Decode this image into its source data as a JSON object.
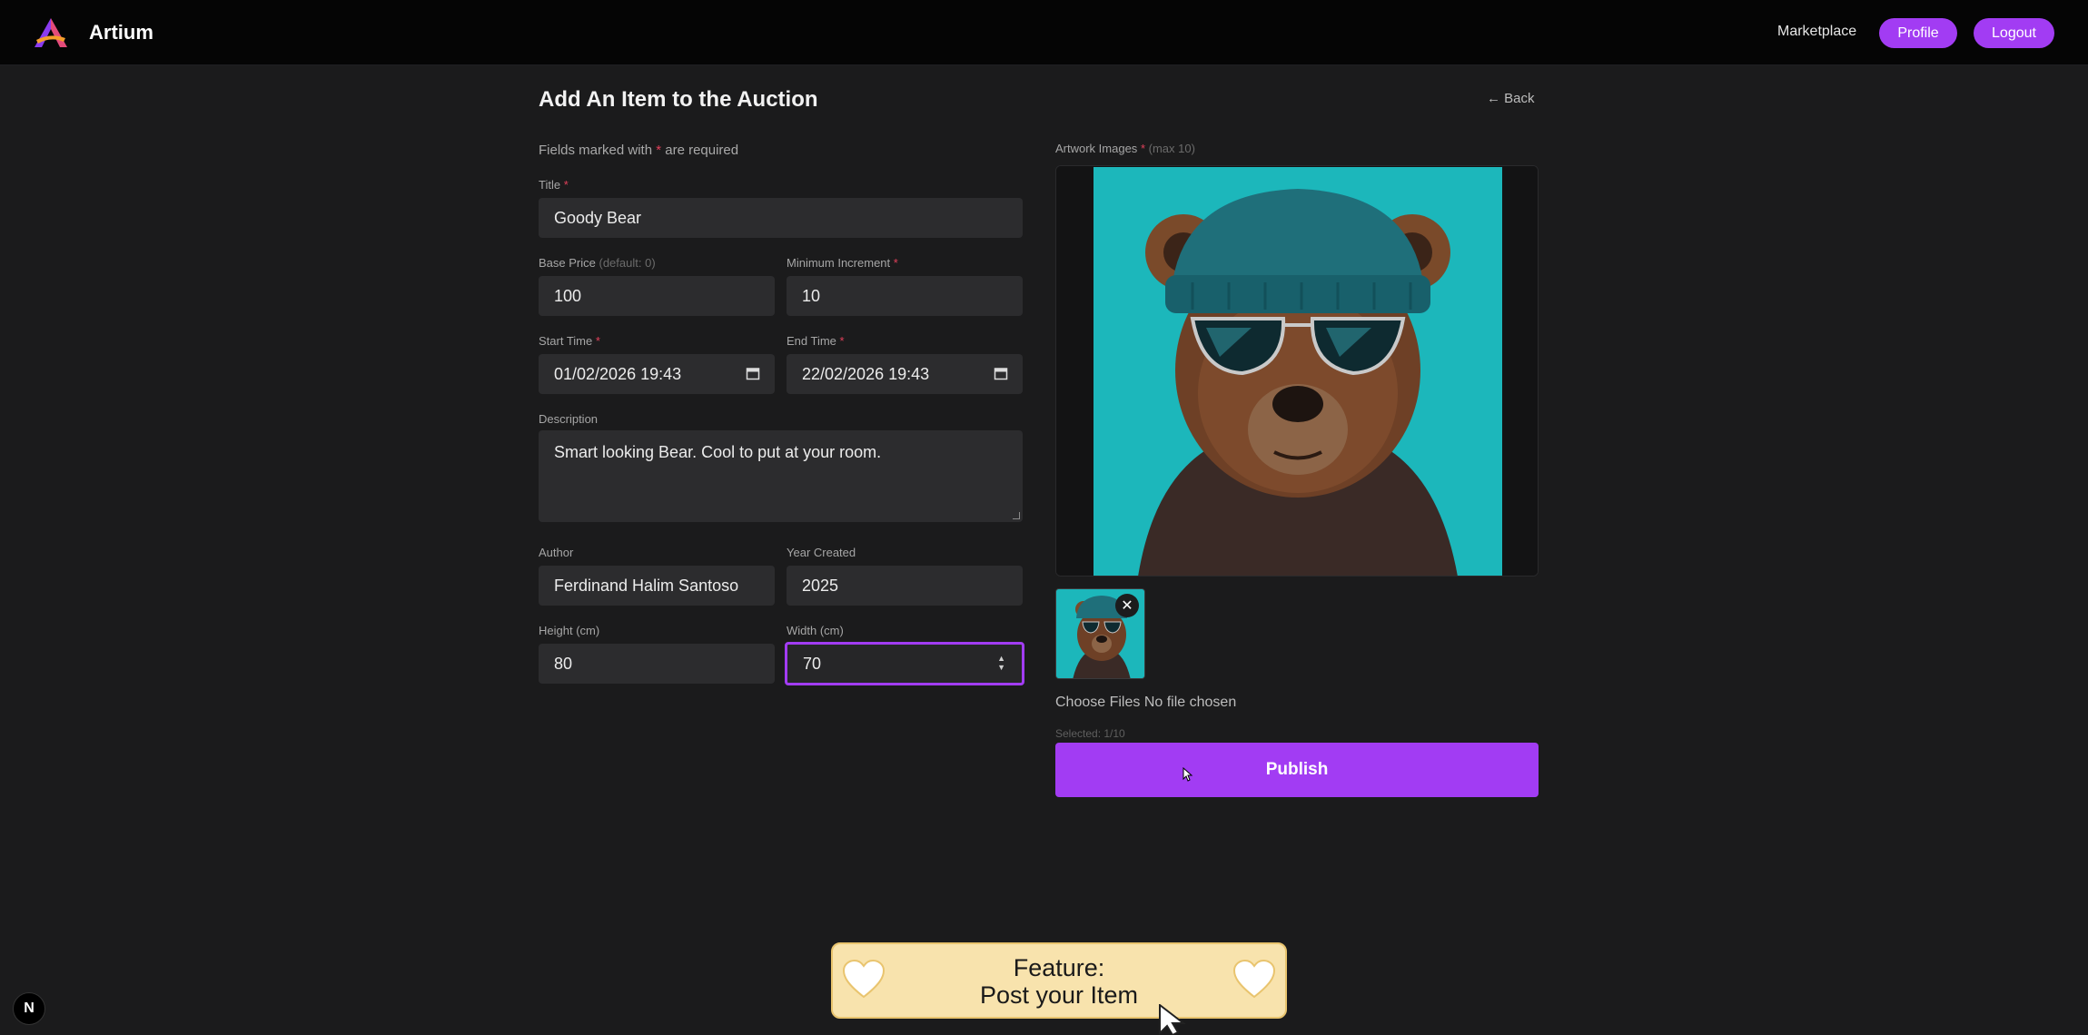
{
  "app": {
    "name": "Artium"
  },
  "nav": {
    "marketplace": "Marketplace",
    "profile": "Profile",
    "logout": "Logout"
  },
  "page": {
    "title": "Add An Item to the Auction",
    "back": "← Back"
  },
  "form": {
    "required_note_prefix": "Fields marked with",
    "required_star": "*",
    "required_note_suffix": "are required",
    "title": {
      "label": "Title",
      "value": "Goody Bear"
    },
    "base_price": {
      "label": "Base Price",
      "hint": "(default: 0)",
      "value": "100"
    },
    "min_increment": {
      "label": "Minimum Increment",
      "value": "10"
    },
    "start_time": {
      "label": "Start Time",
      "value": "01/02/2026 19:43"
    },
    "end_time": {
      "label": "End Time",
      "value": "22/02/2026 19:43"
    },
    "description": {
      "label": "Description",
      "value": "Smart looking Bear. Cool to put at your room."
    },
    "author": {
      "label": "Author",
      "value": "Ferdinand Halim Santoso"
    },
    "year_created": {
      "label": "Year Created",
      "value": "2025"
    },
    "height": {
      "label": "Height (cm)",
      "value": "80"
    },
    "width": {
      "label": "Width (cm)",
      "value": "70"
    }
  },
  "artwork": {
    "label": "Artwork Images",
    "hint": "(max 10)",
    "file_input_text": "Choose Files No file chosen",
    "selected": "Selected: 1/10",
    "remove_symbol": "✕"
  },
  "publish": {
    "label": "Publish"
  },
  "feature_banner": {
    "line1": "Feature:",
    "line2": "Post your Item"
  },
  "dev_badge": {
    "text": "N"
  },
  "colors": {
    "accent": "#a23cf3",
    "background": "#1b1b1c",
    "required": "#e0405a",
    "banner": "#f8e3ad"
  }
}
